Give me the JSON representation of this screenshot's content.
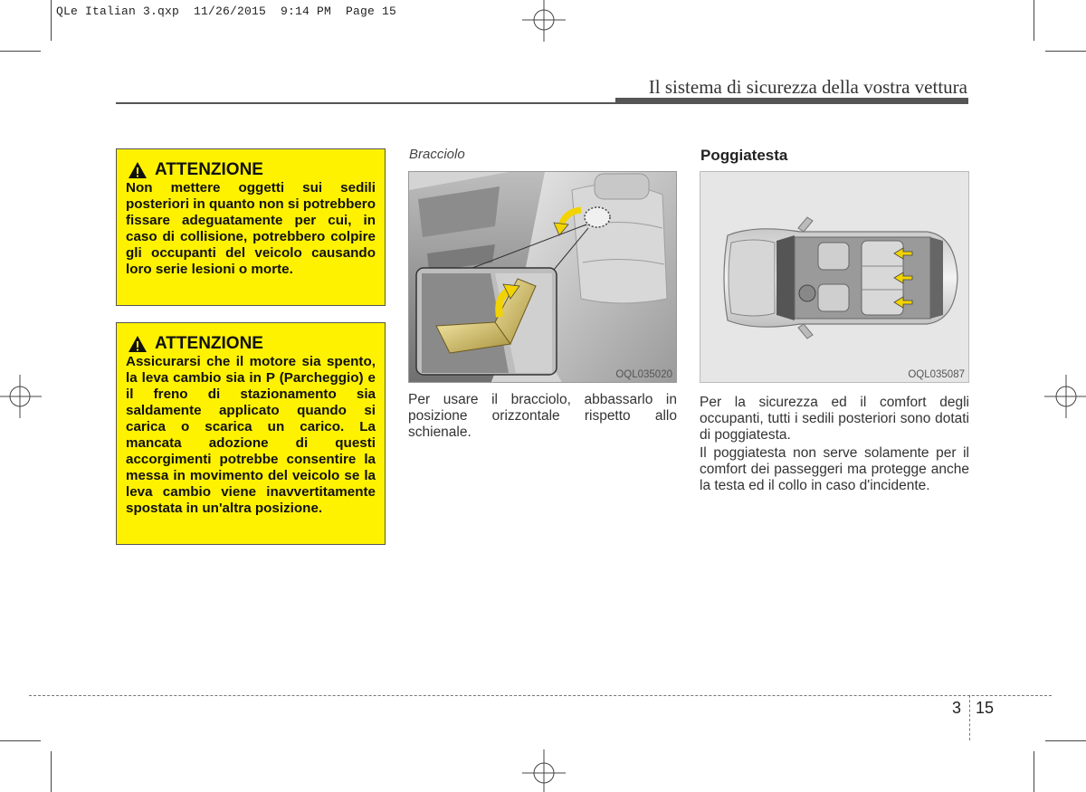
{
  "slug_line": "QLe Italian 3.qxp  11/26/2015  9:14 PM  Page 15",
  "header": {
    "title": "Il sistema di sicurezza della vostra vettura"
  },
  "warnings": [
    {
      "heading": "ATTENZIONE",
      "text": "Non mettere oggetti sui sedili posteriori in quanto non si potrebbero fissare adeguatamente per cui, in caso di collisione, potrebbero colpire gli occupanti del veicolo causando loro serie lesioni o morte."
    },
    {
      "heading": "ATTENZIONE",
      "text": "Assicurarsi che il motore sia spento, la leva cambio sia in P (Parcheggio) e il freno di stazionamento sia saldamente applicato quando si carica o scarica un carico. La mancata adozione di questi accorgimenti potrebbe consentire la messa in movimento del veicolo se la leva cambio viene inavvertitamente spostata in un'altra posizione."
    }
  ],
  "bracciolo": {
    "heading": "Bracciolo",
    "figure_code": "OQL035020",
    "text": "Per usare il bracciolo, abbassarlo in posizione orizzontale rispetto allo schienale."
  },
  "poggiatesta": {
    "heading": "Poggiatesta",
    "figure_code": "OQL035087",
    "paragraphs": [
      "Per la sicurezza ed il comfort degli occupanti, tutti i sedili posteriori sono dotati di poggiatesta.",
      "Il poggiatesta non serve solamente per il comfort dei passeggeri ma protegge anche la testa ed il collo in caso d'incidente."
    ]
  },
  "footer": {
    "chapter": "3",
    "page": "15"
  },
  "colors": {
    "warning_bg": "#fff200",
    "arrow": "#f2d300",
    "rule": "#555555"
  }
}
